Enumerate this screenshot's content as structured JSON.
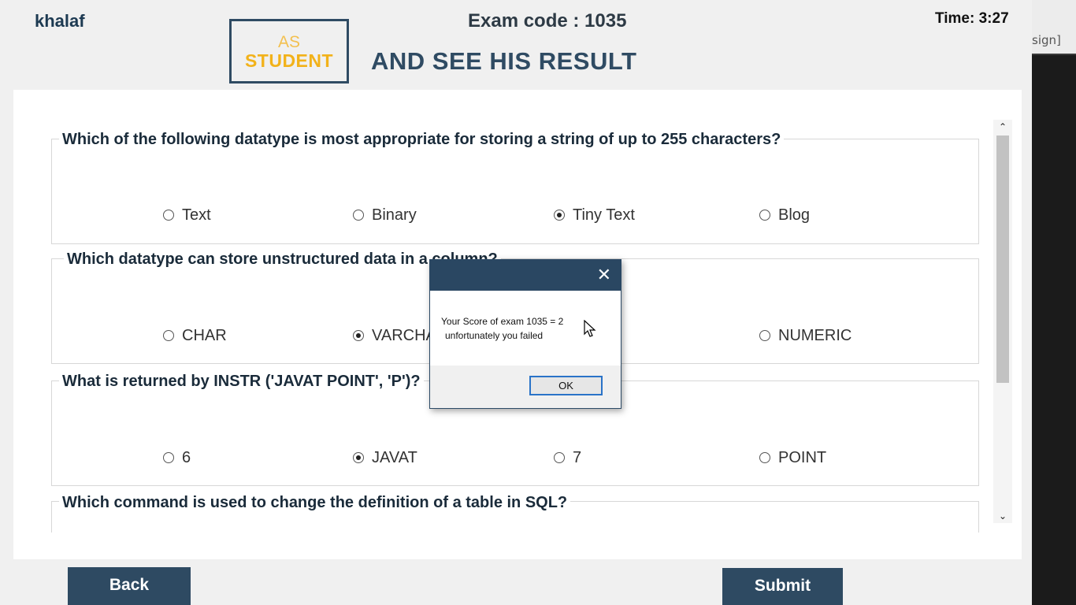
{
  "header": {
    "username": "khalaf",
    "logo": {
      "line1": "AS",
      "line2": "STUDENT"
    },
    "exam_code": "Exam code : 1035",
    "timer": "Time: 3:27",
    "headline": "AND SEE HIS RESULT"
  },
  "side_window": {
    "partial_text": "sign]"
  },
  "questions": [
    {
      "text": "Which of the following datatype is most appropriate for storing a string of up to 255 characters?",
      "options": [
        "Text",
        "Binary",
        "Tiny Text",
        "Blog"
      ],
      "selected": "Tiny Text"
    },
    {
      "text": "Which datatype can store unstructured data in a column?",
      "options": [
        "CHAR",
        "VARCHAR",
        "",
        "NUMERIC"
      ],
      "selected": "VARCHAR"
    },
    {
      "text": "What is returned by INSTR ('JAVAT POINT', 'P')?",
      "options": [
        "6",
        "JAVAT",
        "7",
        "POINT"
      ],
      "selected": "JAVAT"
    },
    {
      "text": "Which command is used to change the definition of a table in SQL?",
      "options": [],
      "selected": ""
    }
  ],
  "scrollbar": {
    "up_glyph": "⌃",
    "down_glyph": "⌄"
  },
  "buttons": {
    "back": "Back",
    "submit": "Submit"
  },
  "dialog": {
    "close_glyph": "✕",
    "line1": "Your Score of exam 1035 = 2",
    "line2": "unfortunately you failed",
    "ok": "OK"
  },
  "colors": {
    "navy": "#2e4a62",
    "logo_gold": "#f2b21a",
    "dialog_title": "#2a4762",
    "ok_focus_border": "#2a73c8"
  }
}
